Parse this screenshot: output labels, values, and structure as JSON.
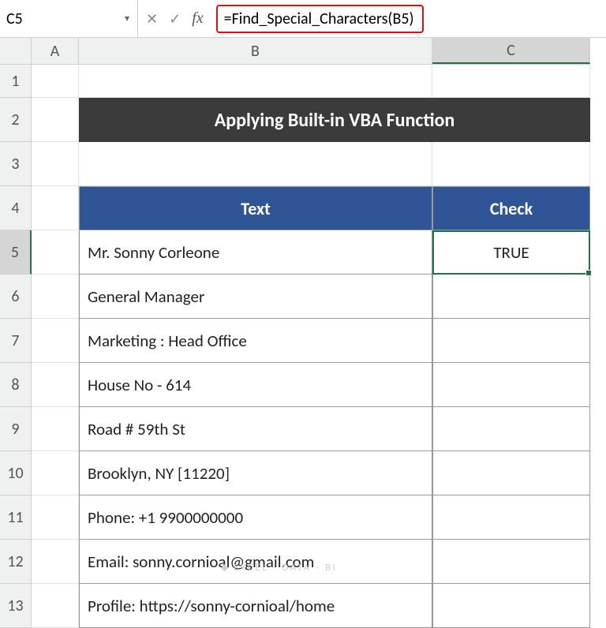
{
  "nameBox": "C5",
  "formula": "=Find_Special_Characters(B5)",
  "columns": [
    "A",
    "B",
    "C"
  ],
  "rows": [
    "1",
    "2",
    "3",
    "4",
    "5",
    "6",
    "7",
    "8",
    "9",
    "10",
    "11",
    "12",
    "13"
  ],
  "title": "Applying Built-in VBA Function",
  "headers": {
    "text": "Text",
    "check": "Check"
  },
  "data": [
    {
      "text": "Mr. Sonny Corleone",
      "check": "TRUE"
    },
    {
      "text": "General Manager",
      "check": ""
    },
    {
      "text": "Marketing : Head Office",
      "check": ""
    },
    {
      "text": "House No - 614",
      "check": ""
    },
    {
      "text": "Road # 59th St",
      "check": ""
    },
    {
      "text": "Brooklyn, NY [11220]",
      "check": ""
    },
    {
      "text": "Phone: +1 9900000000",
      "check": ""
    },
    {
      "text": "Email: sonny.cornioal@gmail.com",
      "check": ""
    },
    {
      "text": "Profile: https://sonny-cornioal/home",
      "check": ""
    }
  ],
  "watermark": "EXCEL · DATA · BI"
}
